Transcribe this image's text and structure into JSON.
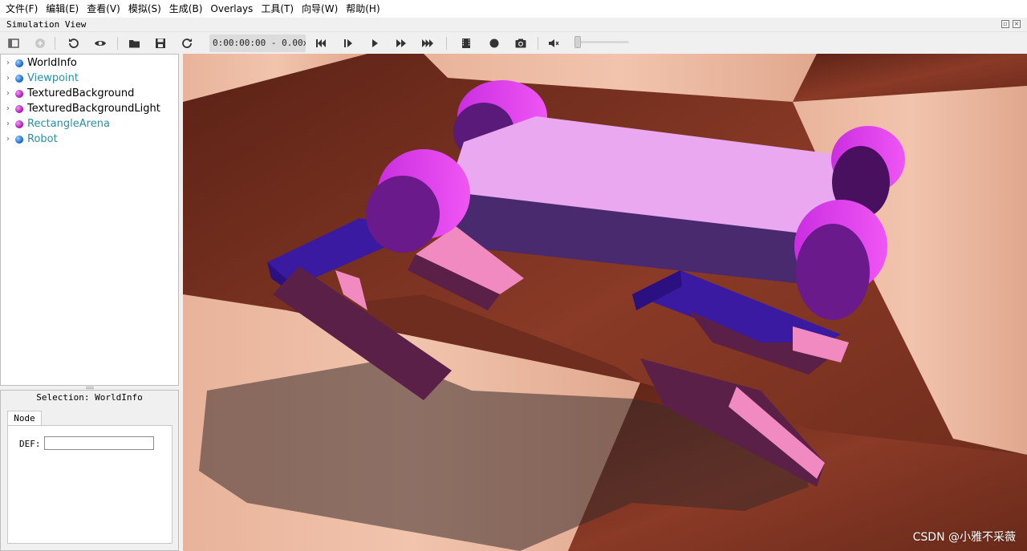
{
  "menu": [
    "文件(F)",
    "编辑(E)",
    "查看(V)",
    "模拟(S)",
    "生成(B)",
    "Overlays",
    "工具(T)",
    "向导(W)",
    "帮助(H)"
  ],
  "window": {
    "title": "Simulation View"
  },
  "toolbar": {
    "time_display": "0:00:00:00 - 0.00x",
    "icons": [
      "panel-toggle-icon",
      "add-node-icon",
      "reload-icon",
      "eye-icon",
      "open-world-icon",
      "save-world-icon",
      "revert-icon",
      "step-back-icon",
      "step-icon",
      "play-icon",
      "fast-forward-icon",
      "fastest-icon",
      "record-movie-icon",
      "record-icon",
      "screenshot-icon",
      "volume-icon"
    ],
    "volume_level": 0
  },
  "scene_tree": {
    "items": [
      {
        "label": "WorldInfo",
        "ball": "blue",
        "highlight": false
      },
      {
        "label": "Viewpoint",
        "ball": "blue",
        "highlight": true
      },
      {
        "label": "TexturedBackground",
        "ball": "purple",
        "highlight": false
      },
      {
        "label": "TexturedBackgroundLight",
        "ball": "purple",
        "highlight": false
      },
      {
        "label": "RectangleArena",
        "ball": "purple",
        "highlight": true
      },
      {
        "label": "Robot",
        "ball": "blue",
        "highlight": true
      }
    ]
  },
  "node_editor": {
    "selection": "Selection: WorldInfo",
    "tab": "Node",
    "def_label": "DEF:",
    "def_value": ""
  },
  "viewport": {
    "watermark": "CSDN @小雅不采薇",
    "colors": {
      "light_floor": "#e9b49a",
      "dark_floor": "#7a3322",
      "body_top": "#eaa8f0",
      "body_side": "#4a2a6e",
      "wheel_face": "#6a1a8a",
      "wheel_side": "#e040f0",
      "thigh": "#3a1aa0",
      "shin_light": "#f08ac0",
      "shin_dark": "#5a2048"
    }
  }
}
